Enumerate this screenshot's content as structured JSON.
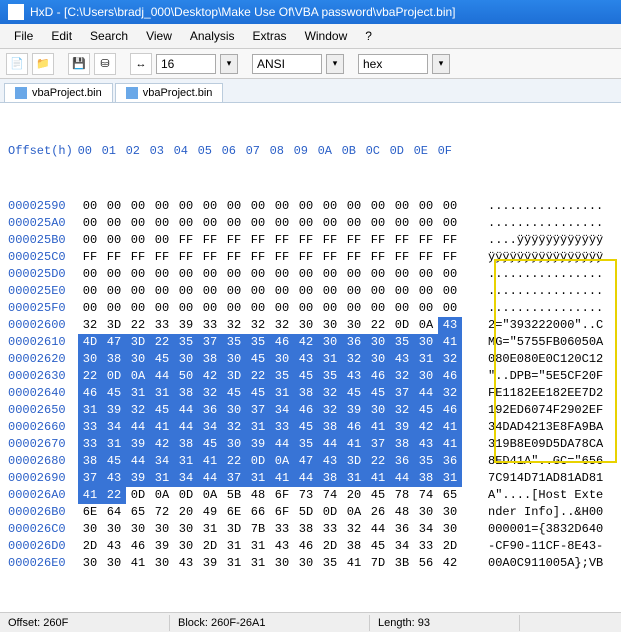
{
  "window": {
    "title": "HxD - [C:\\Users\\bradj_000\\Desktop\\Make Use Of\\VBA password\\vbaProject.bin]"
  },
  "menu": {
    "file": "File",
    "edit": "Edit",
    "search": "Search",
    "view": "View",
    "analysis": "Analysis",
    "extras": "Extras",
    "window": "Window",
    "help": "?"
  },
  "toolbar": {
    "bytes_per_row": "16",
    "encoding": "ANSI",
    "data_type": "hex"
  },
  "tabs": {
    "t1": "vbaProject.bin",
    "t2": "vbaProject.bin"
  },
  "hex": {
    "header_label": "Offset(h)",
    "cols": [
      "00",
      "01",
      "02",
      "03",
      "04",
      "05",
      "06",
      "07",
      "08",
      "09",
      "0A",
      "0B",
      "0C",
      "0D",
      "0E",
      "0F"
    ],
    "rows": [
      {
        "off": "00002590",
        "b": [
          "00",
          "00",
          "00",
          "00",
          "00",
          "00",
          "00",
          "00",
          "00",
          "00",
          "00",
          "00",
          "00",
          "00",
          "00",
          "00"
        ],
        "a": "................"
      },
      {
        "off": "000025A0",
        "b": [
          "00",
          "00",
          "00",
          "00",
          "00",
          "00",
          "00",
          "00",
          "00",
          "00",
          "00",
          "00",
          "00",
          "00",
          "00",
          "00"
        ],
        "a": "................"
      },
      {
        "off": "000025B0",
        "b": [
          "00",
          "00",
          "00",
          "00",
          "FF",
          "FF",
          "FF",
          "FF",
          "FF",
          "FF",
          "FF",
          "FF",
          "FF",
          "FF",
          "FF",
          "FF"
        ],
        "a": "....ÿÿÿÿÿÿÿÿÿÿÿÿ"
      },
      {
        "off": "000025C0",
        "b": [
          "FF",
          "FF",
          "FF",
          "FF",
          "FF",
          "FF",
          "FF",
          "FF",
          "FF",
          "FF",
          "FF",
          "FF",
          "FF",
          "FF",
          "FF",
          "FF"
        ],
        "a": "ÿÿÿÿÿÿÿÿÿÿÿÿÿÿÿÿ"
      },
      {
        "off": "000025D0",
        "b": [
          "00",
          "00",
          "00",
          "00",
          "00",
          "00",
          "00",
          "00",
          "00",
          "00",
          "00",
          "00",
          "00",
          "00",
          "00",
          "00"
        ],
        "a": "................"
      },
      {
        "off": "000025E0",
        "b": [
          "00",
          "00",
          "00",
          "00",
          "00",
          "00",
          "00",
          "00",
          "00",
          "00",
          "00",
          "00",
          "00",
          "00",
          "00",
          "00"
        ],
        "a": "................"
      },
      {
        "off": "000025F0",
        "b": [
          "00",
          "00",
          "00",
          "00",
          "00",
          "00",
          "00",
          "00",
          "00",
          "00",
          "00",
          "00",
          "00",
          "00",
          "00",
          "00"
        ],
        "a": "................"
      },
      {
        "off": "00002600",
        "b": [
          "32",
          "3D",
          "22",
          "33",
          "39",
          "33",
          "32",
          "32",
          "32",
          "30",
          "30",
          "30",
          "22",
          "0D",
          "0A",
          "43"
        ],
        "a": "2=\"393222000\"..C",
        "selStart": 15
      },
      {
        "off": "00002610",
        "b": [
          "4D",
          "47",
          "3D",
          "22",
          "35",
          "37",
          "35",
          "35",
          "46",
          "42",
          "30",
          "36",
          "30",
          "35",
          "30",
          "41"
        ],
        "a": "MG=\"5755FB06050A",
        "allSel": true
      },
      {
        "off": "00002620",
        "b": [
          "30",
          "38",
          "30",
          "45",
          "30",
          "38",
          "30",
          "45",
          "30",
          "43",
          "31",
          "32",
          "30",
          "43",
          "31",
          "32"
        ],
        "a": "080E080E0C120C12",
        "allSel": true
      },
      {
        "off": "00002630",
        "b": [
          "22",
          "0D",
          "0A",
          "44",
          "50",
          "42",
          "3D",
          "22",
          "35",
          "45",
          "35",
          "43",
          "46",
          "32",
          "30",
          "46"
        ],
        "a": "\"..DPB=\"5E5CF20F",
        "allSel": true
      },
      {
        "off": "00002640",
        "b": [
          "46",
          "45",
          "31",
          "31",
          "38",
          "32",
          "45",
          "45",
          "31",
          "38",
          "32",
          "45",
          "45",
          "37",
          "44",
          "32"
        ],
        "a": "FE1182EE182EE7D2",
        "allSel": true
      },
      {
        "off": "00002650",
        "b": [
          "31",
          "39",
          "32",
          "45",
          "44",
          "36",
          "30",
          "37",
          "34",
          "46",
          "32",
          "39",
          "30",
          "32",
          "45",
          "46"
        ],
        "a": "192ED6074F2902EF",
        "allSel": true
      },
      {
        "off": "00002660",
        "b": [
          "33",
          "34",
          "44",
          "41",
          "44",
          "34",
          "32",
          "31",
          "33",
          "45",
          "38",
          "46",
          "41",
          "39",
          "42",
          "41"
        ],
        "a": "34DAD4213E8FA9BA",
        "allSel": true
      },
      {
        "off": "00002670",
        "b": [
          "33",
          "31",
          "39",
          "42",
          "38",
          "45",
          "30",
          "39",
          "44",
          "35",
          "44",
          "41",
          "37",
          "38",
          "43",
          "41"
        ],
        "a": "319B8E09D5DA78CA",
        "allSel": true
      },
      {
        "off": "00002680",
        "b": [
          "38",
          "45",
          "44",
          "34",
          "31",
          "41",
          "22",
          "0D",
          "0A",
          "47",
          "43",
          "3D",
          "22",
          "36",
          "35",
          "36"
        ],
        "a": "8ED41A\"..GC=\"656",
        "allSel": true
      },
      {
        "off": "00002690",
        "b": [
          "37",
          "43",
          "39",
          "31",
          "34",
          "44",
          "37",
          "31",
          "41",
          "44",
          "38",
          "31",
          "41",
          "44",
          "38",
          "31"
        ],
        "a": "7C914D71AD81AD81",
        "allSel": true
      },
      {
        "off": "000026A0",
        "b": [
          "41",
          "22",
          "0D",
          "0A",
          "0D",
          "0A",
          "5B",
          "48",
          "6F",
          "73",
          "74",
          "20",
          "45",
          "78",
          "74",
          "65"
        ],
        "a": "A\"....[Host Exte",
        "selEnd": 1
      },
      {
        "off": "000026B0",
        "b": [
          "6E",
          "64",
          "65",
          "72",
          "20",
          "49",
          "6E",
          "66",
          "6F",
          "5D",
          "0D",
          "0A",
          "26",
          "48",
          "30",
          "30"
        ],
        "a": "nder Info]..&H00"
      },
      {
        "off": "000026C0",
        "b": [
          "30",
          "30",
          "30",
          "30",
          "30",
          "31",
          "3D",
          "7B",
          "33",
          "38",
          "33",
          "32",
          "44",
          "36",
          "34",
          "30"
        ],
        "a": "000001={3832D640"
      },
      {
        "off": "000026D0",
        "b": [
          "2D",
          "43",
          "46",
          "39",
          "30",
          "2D",
          "31",
          "31",
          "43",
          "46",
          "2D",
          "38",
          "45",
          "34",
          "33",
          "2D"
        ],
        "a": "-CF90-11CF-8E43-"
      },
      {
        "off": "000026E0",
        "b": [
          "30",
          "30",
          "41",
          "30",
          "43",
          "39",
          "31",
          "31",
          "30",
          "30",
          "35",
          "41",
          "7D",
          "3B",
          "56",
          "42"
        ],
        "a": "00A0C911005A};VB"
      }
    ]
  },
  "status": {
    "offset_label": "Offset: 260F",
    "block_label": "Block: 260F-26A1",
    "length_label": "Length: 93"
  }
}
